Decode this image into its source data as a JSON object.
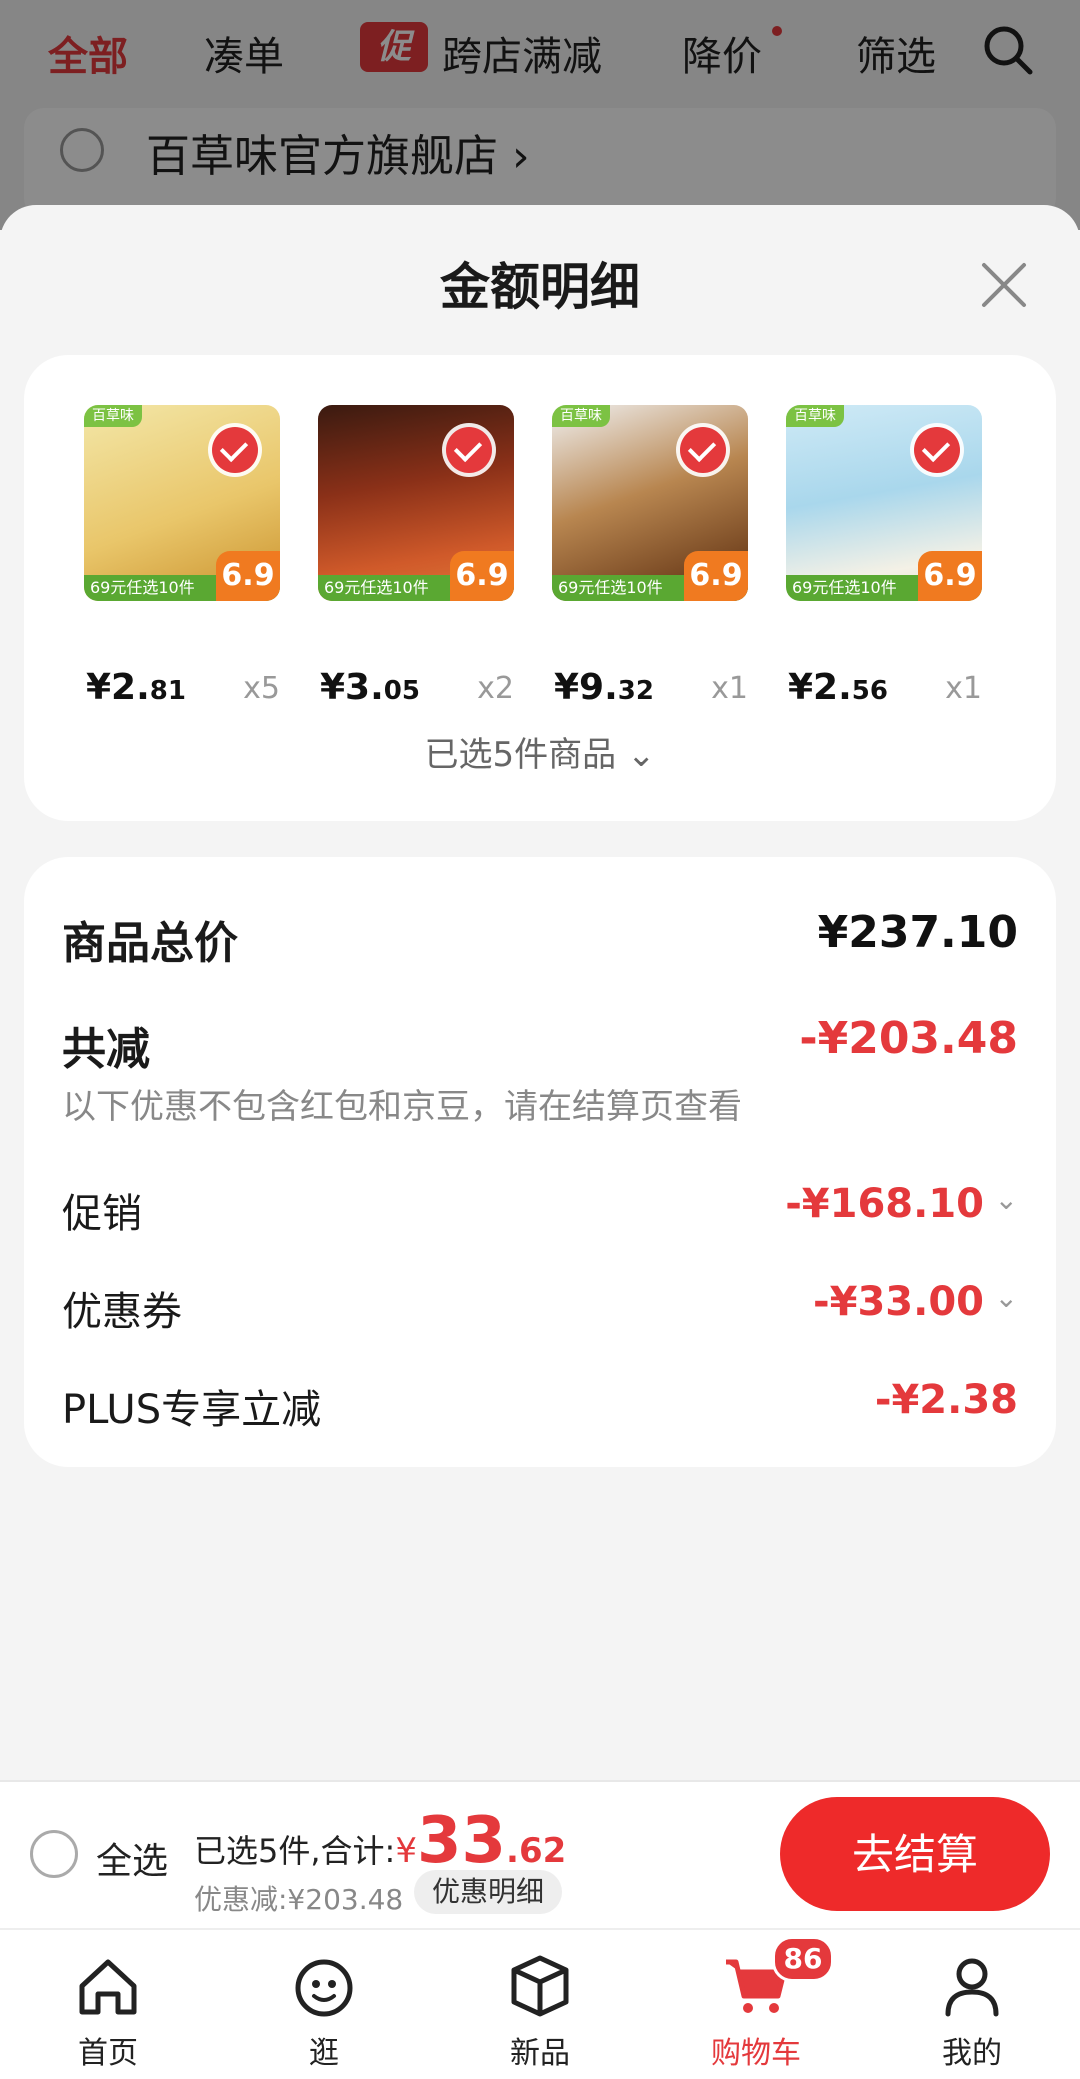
{
  "filter_bar": {
    "items": [
      "全部",
      "凑单",
      "跨店满减",
      "降价",
      "筛选"
    ],
    "promo_tag": "促"
  },
  "shop": {
    "name": "百草味官方旗舰店 ›"
  },
  "sheet": {
    "title": "金额明细",
    "products": [
      {
        "brand": "百草味",
        "price_int": "¥2.",
        "price_dec": "81",
        "qty": "x5",
        "band": "69元任选10件",
        "badge": "6.9",
        "color": "#e9c66a"
      },
      {
        "brand": "",
        "price_int": "¥3.",
        "price_dec": "05",
        "qty": "x2",
        "band": "69元任选10件",
        "badge": "6.9",
        "color": "#b3452a"
      },
      {
        "brand": "百草味",
        "price_int": "¥9.",
        "price_dec": "32",
        "qty": "x1",
        "band": "69元任选10件",
        "badge": "6.9",
        "color": "#9a6a3a"
      },
      {
        "brand": "百草味",
        "price_int": "¥2.",
        "price_dec": "56",
        "qty": "x1",
        "band": "69元任选10件",
        "badge": "6.9",
        "color": "#a9d7ec"
      }
    ],
    "selected_count": "已选5件商品 ⌄",
    "summary": {
      "total_label": "商品总价",
      "total_value": "¥237.10",
      "reduce_label": "共减",
      "reduce_value": "-¥203.48",
      "note": "以下优惠不包含红包和京豆，请在结算页查看",
      "promo_label": "促销",
      "promo_value": "-¥168.10",
      "coupon_label": "优惠券",
      "coupon_value": "-¥33.00",
      "plus_label": "PLUS专享立减",
      "plus_value": "-¥2.38"
    }
  },
  "checkout": {
    "select_all": "全选",
    "summary_prefix": "已选5件,合计:",
    "yen": "¥",
    "total_int": "33",
    "total_dec": ".62",
    "discount": "优惠减:¥203.48",
    "detail_chip": "优惠明细",
    "button": "去结算"
  },
  "tabs": [
    {
      "label": "首页",
      "icon": "home-icon"
    },
    {
      "label": "逛",
      "icon": "face-icon"
    },
    {
      "label": "新品",
      "icon": "box-icon"
    },
    {
      "label": "购物车",
      "icon": "cart-icon"
    },
    {
      "label": "我的",
      "icon": "person-icon"
    }
  ],
  "cart_badge": "86",
  "colors": {
    "accent": "#e4393c",
    "button": "#ee2a2a"
  }
}
